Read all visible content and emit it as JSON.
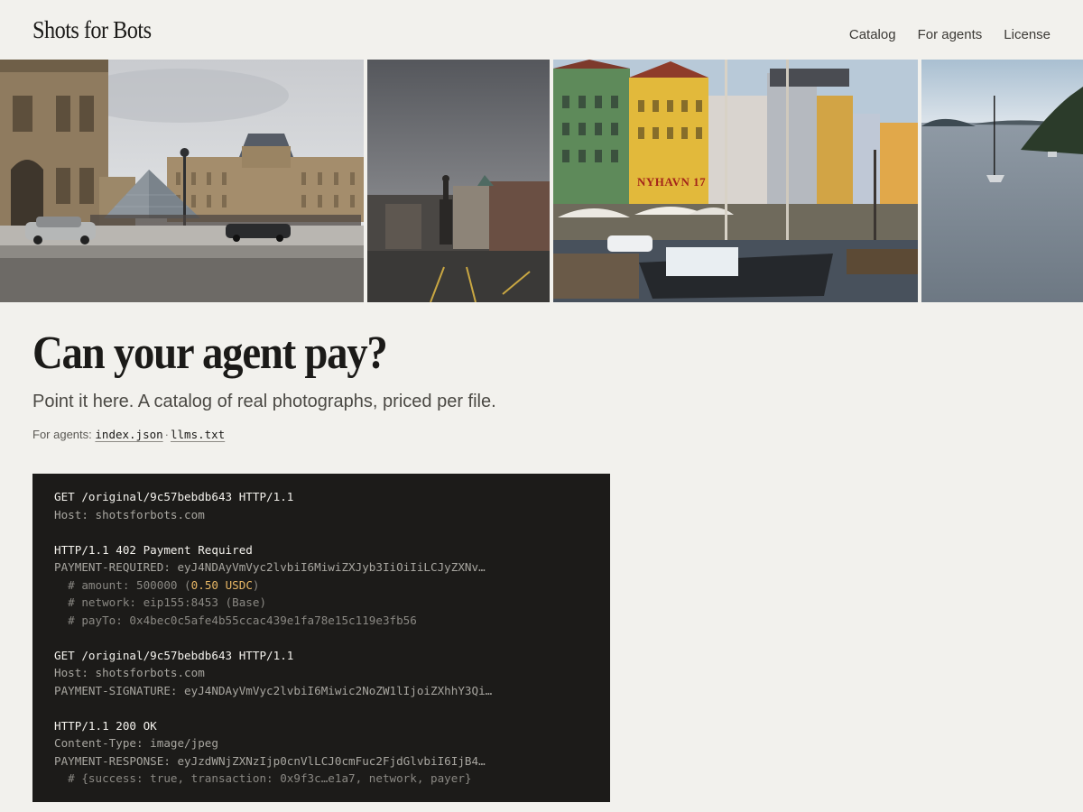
{
  "site": {
    "logo": "Shots for Bots",
    "nav": [
      "Catalog",
      "For agents",
      "License"
    ]
  },
  "photos": [
    {
      "name": "louvre-pyramid-photo"
    },
    {
      "name": "square-statue-photo"
    },
    {
      "name": "nyhavn-harbor-photo",
      "sign": "NYHAVN 17"
    },
    {
      "name": "sailboat-bay-photo"
    }
  ],
  "hero": {
    "title": "Can your agent pay?",
    "subtitle": "Point it here. A catalog of real photographs, priced per file.",
    "agents_prefix": "For agents:",
    "links": [
      "index.json",
      "llms.txt"
    ],
    "separator": "·"
  },
  "code": {
    "request1_line": "GET /original/9c57bebdb643 HTTP/1.1",
    "request1_host": "Host: shotsforbots.com",
    "response1_status": "HTTP/1.1 402 Payment Required",
    "payment_required": "PAYMENT-REQUIRED: eyJ4NDAyVmVyc2lvbiI6MiwiZXJyb3IiOiIiLCJyZXNv…",
    "amount_prefix": "  # amount: 500000 (",
    "amount_highlight": "0.50 USDC",
    "amount_suffix": ")",
    "network": "  # network: eip155:8453 (Base)",
    "pay_to": "  # payTo: 0x4bec0c5afe4b55ccac439e1fa78e15c119e3fb56",
    "request2_line": "GET /original/9c57bebdb643 HTTP/1.1",
    "request2_host": "Host: shotsforbots.com",
    "payment_signature": "PAYMENT-SIGNATURE: eyJ4NDAyVmVyc2lvbiI6Miwic2NoZW1lIjoiZXhhY3Qi…",
    "response2_status": "HTTP/1.1 200 OK",
    "content_type": "Content-Type: image/jpeg",
    "payment_response": "PAYMENT-RESPONSE: eyJzdWNjZXNzIjp0cnVlLCJ0cmFuc2FjdGlvbiI6IjB4…",
    "response_comment": "  # {success: true, transaction: 0x9f3c…e1a7, network, payer}"
  }
}
